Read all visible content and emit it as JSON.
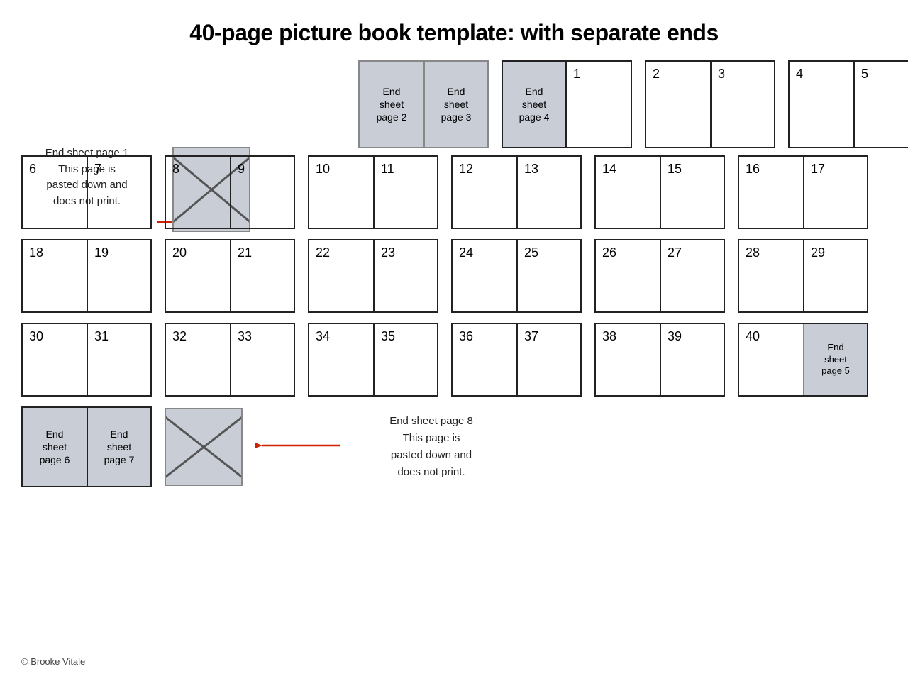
{
  "title": "40-page picture book template: with separate ends",
  "annotation_top": {
    "line1": "End sheet page 1",
    "line2": "This page is",
    "line3": "pasted down and",
    "line4": "does not print."
  },
  "annotation_bottom": {
    "line1": "End sheet page 8",
    "line2": "This page is",
    "line3": "pasted down and",
    "line4": "does not print."
  },
  "copyright": "© Brooke Vitale",
  "row1": {
    "end2": "End\nsheet\npage 2",
    "end3": "End\nsheet\npage 3",
    "end4": "End\nsheet\npage 4",
    "p1": "1",
    "p2": "2",
    "p3": "3",
    "p4": "4",
    "p5": "5"
  },
  "row2": {
    "pages": [
      "6",
      "7",
      "8",
      "9",
      "10",
      "11",
      "12",
      "13",
      "14",
      "15",
      "16",
      "17"
    ]
  },
  "row3": {
    "pages": [
      "18",
      "19",
      "20",
      "21",
      "22",
      "23",
      "24",
      "25",
      "26",
      "27",
      "28",
      "29"
    ]
  },
  "row4": {
    "pages": [
      "30",
      "31",
      "32",
      "33",
      "34",
      "35",
      "36",
      "37",
      "38",
      "39",
      "40"
    ],
    "end5": "End\nsheet\npage 5"
  },
  "bottom": {
    "end6": "End\nsheet\npage 6",
    "end7": "End\nsheet\npage 7"
  }
}
